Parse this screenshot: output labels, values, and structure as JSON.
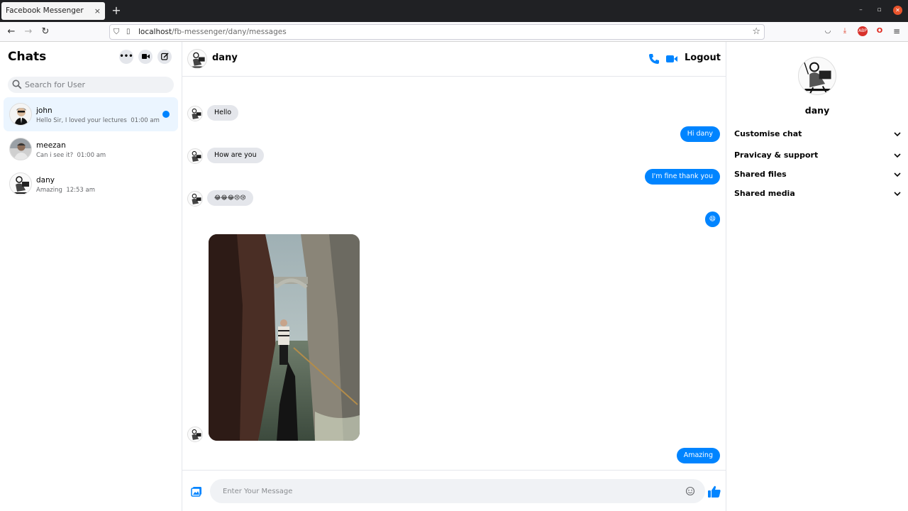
{
  "browser": {
    "tab_title": "Facebook Messenger",
    "tab_close": "×",
    "new_tab": "+",
    "url_host": "localhost",
    "url_path": "/fb-messenger/dany/messages",
    "window_controls": [
      "–",
      "▫",
      "✕"
    ]
  },
  "sidebar": {
    "title": "Chats",
    "search_placeholder": "Search for User",
    "conversations": [
      {
        "name": "john",
        "preview": "Hello Sir, I loved your lectures",
        "time": "01:00 am",
        "active": true,
        "unread": true
      },
      {
        "name": "meezan",
        "preview": "Can i see it?",
        "time": "01:00 am",
        "active": false,
        "unread": false
      },
      {
        "name": "dany",
        "preview": "Amazing",
        "time": "12:53 am",
        "active": false,
        "unread": false
      }
    ]
  },
  "chat": {
    "contact": "dany",
    "logout_label": "Logout",
    "messages": [
      {
        "dir": "in",
        "text": "Hello"
      },
      {
        "dir": "out",
        "text": "Hi dany"
      },
      {
        "dir": "in",
        "text": "How are you"
      },
      {
        "dir": "out",
        "text": "I'm fine thank you"
      },
      {
        "dir": "in",
        "text": "😂😂😂😢😢"
      },
      {
        "dir": "out",
        "text": "😄"
      },
      {
        "dir": "in",
        "type": "image",
        "subject": "gondola-canal-photo"
      },
      {
        "dir": "out",
        "text": "Amazing"
      }
    ],
    "composer_placeholder": "Enter Your Message"
  },
  "info": {
    "name": "dany",
    "sections": [
      "Customise chat",
      "Pravicay & support",
      "Shared files",
      "Shared media"
    ]
  },
  "colors": {
    "accent": "#0084ff",
    "bubble_in": "#e4e6eb",
    "active_row": "#ebf5ff"
  }
}
